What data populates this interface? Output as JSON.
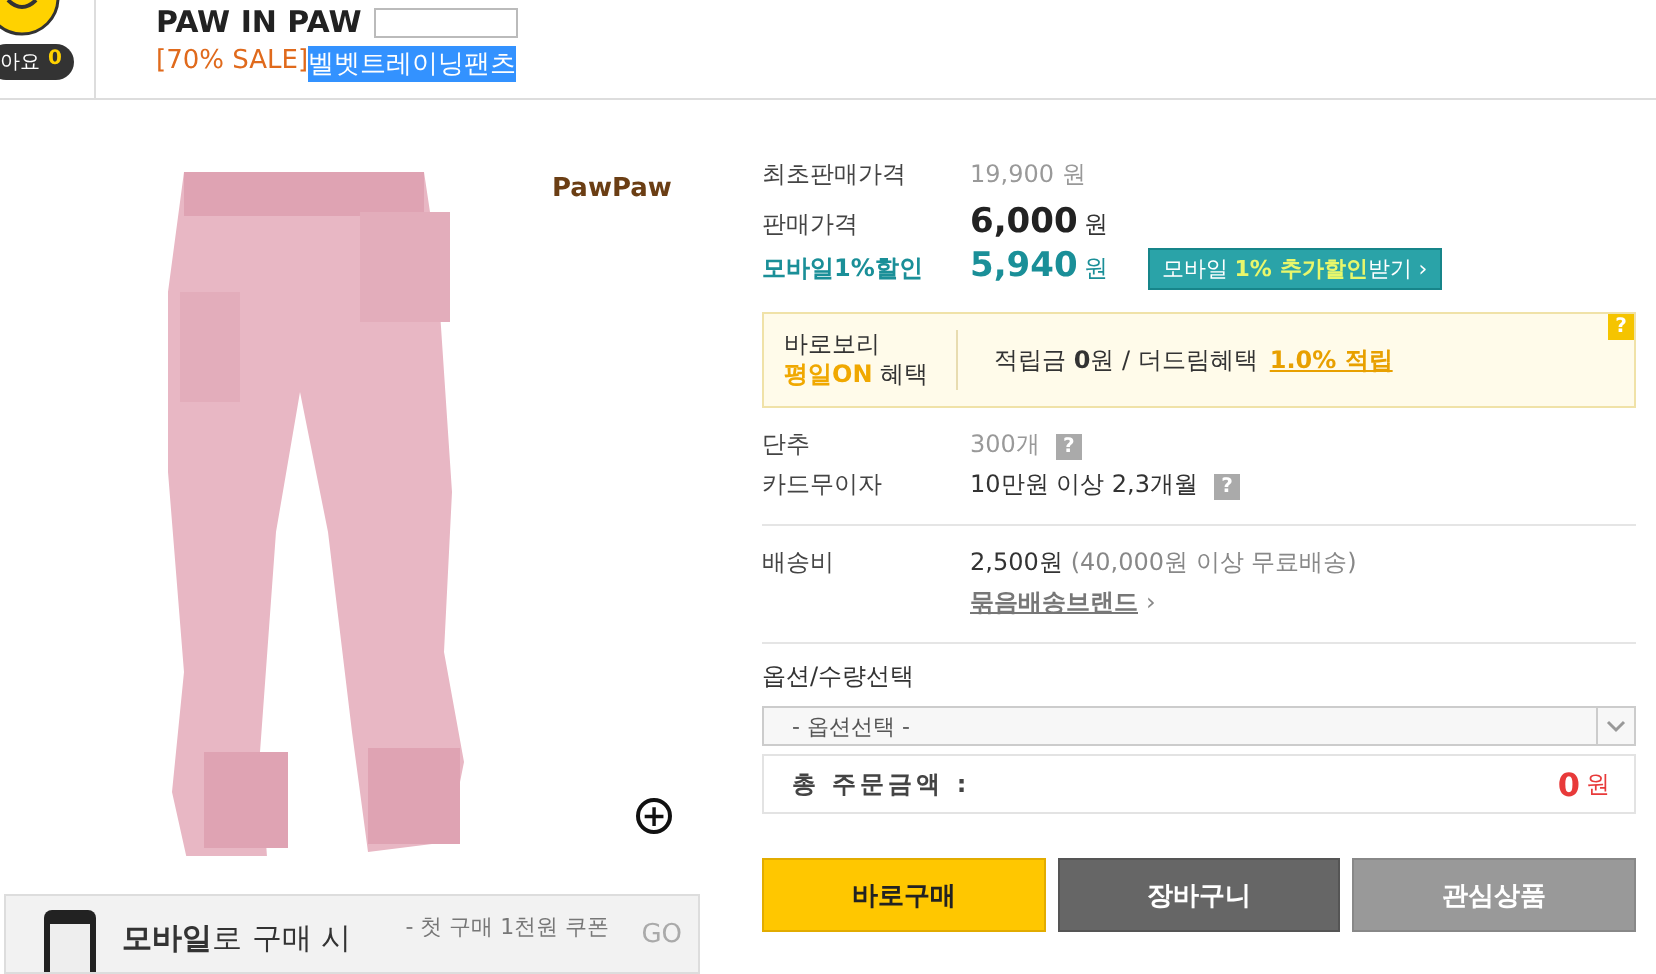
{
  "header": {
    "like_badge": {
      "label": "아요",
      "count": "0"
    },
    "brand": "PAW IN PAW",
    "sale_tag": "[70% SALE]",
    "product_name": "벨벳트레이닝팬츠"
  },
  "gallery": {
    "logo": "PawPaw",
    "zoom": "+"
  },
  "banner": {
    "title": "**모바일**로 구매 시",
    "note": "- 첫 구매 1천원 쿠폰",
    "go": "GO"
  },
  "prices": [
    {
      "kind": "original",
      "label": "최초판매가격",
      "value": "19,900",
      "unit": "원"
    },
    {
      "kind": "sale",
      "label": "판매가격",
      "value": "6,000",
      "unit": "원"
    },
    {
      "kind": "mobile",
      "label": "모바일1%할인",
      "value": "5,940",
      "unit": "원"
    }
  ],
  "mobile_button": "모바일 **1% 추가할인**받기 ›",
  "benefit": {
    "line1": "바로보리",
    "highlight": "평일ON",
    "rest": "혜택",
    "text": "적립금 **0**원 / 더드림혜택",
    "link": "1.0% 적립",
    "help": "?"
  },
  "info": [
    {
      "label": "단추",
      "value": "300개",
      "muted": true,
      "help": "?"
    },
    {
      "label": "카드무이자",
      "value": "10만원 이상 2,3개월",
      "muted": false,
      "help": "?"
    }
  ],
  "shipping": {
    "label": "배송비",
    "value": "2,500원",
    "note": "(40,000원 이상 무료배송)",
    "link": "묶음배송브랜드",
    "arrow": "›"
  },
  "options": {
    "label": "옵션/수량선택",
    "select": "- 옵션선택 -",
    "total_label": "총 주문금액 :",
    "total": "0",
    "unit": "원"
  },
  "buttons": [
    {
      "kind": "buy",
      "label": "바로구매"
    },
    {
      "kind": "cart",
      "label": "장바구니"
    },
    {
      "kind": "wish",
      "label": "관심상품"
    }
  ]
}
